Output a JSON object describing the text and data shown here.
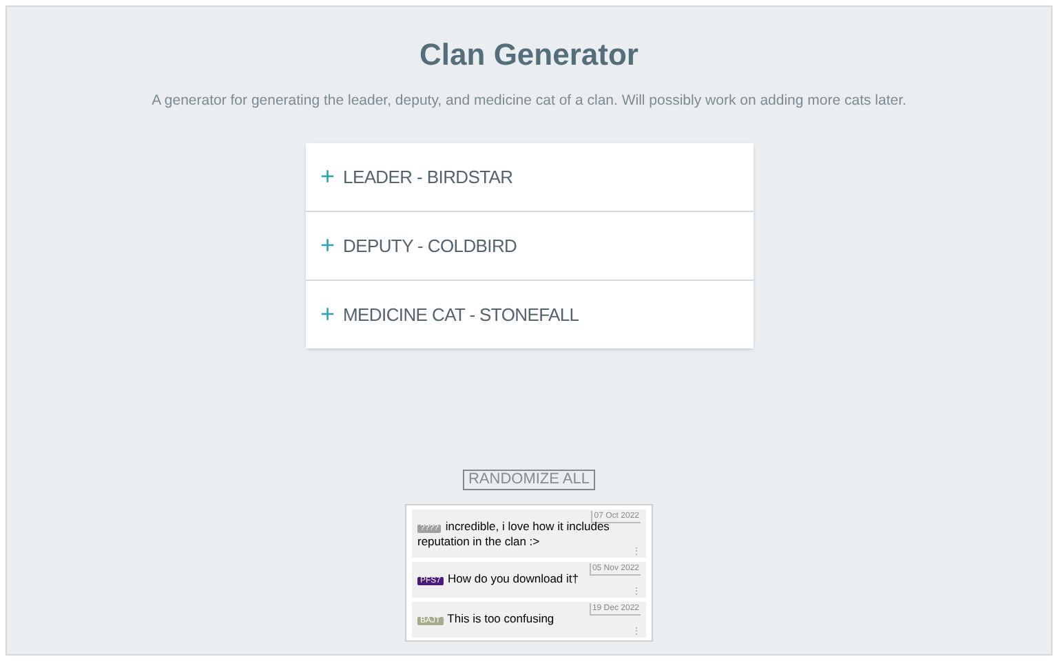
{
  "title": "Clan Generator",
  "description": "A generator for generating the leader, deputy, and medicine cat of a clan. Will possibly work on adding more cats later.",
  "accordion": [
    {
      "icon": "+",
      "label": "LEADER - BIRDSTAR",
      "expanded": false
    },
    {
      "icon": "+",
      "label": "DEPUTY - COLDBIRD",
      "expanded": false
    },
    {
      "icon": "+",
      "label": "MEDICINE CAT - STONEFALL",
      "expanded": false
    }
  ],
  "randomize_button": "RANDOMIZE ALL",
  "comments": [
    {
      "badge": "????",
      "color": "#9e9e9e",
      "text": "incredible, i love how it includes reputation in the clan :>",
      "date": "07 Oct 2022",
      "menu": "⋮"
    },
    {
      "badge": "PFS7",
      "color": "#4a1a7c",
      "text": "How do you download it†",
      "date": "05 Nov 2022",
      "menu": "⋮"
    },
    {
      "badge": "BAJT",
      "color": "#a6ab8c",
      "text": "This is too confusing",
      "date": "19 Dec 2022",
      "menu": "⋮"
    }
  ]
}
